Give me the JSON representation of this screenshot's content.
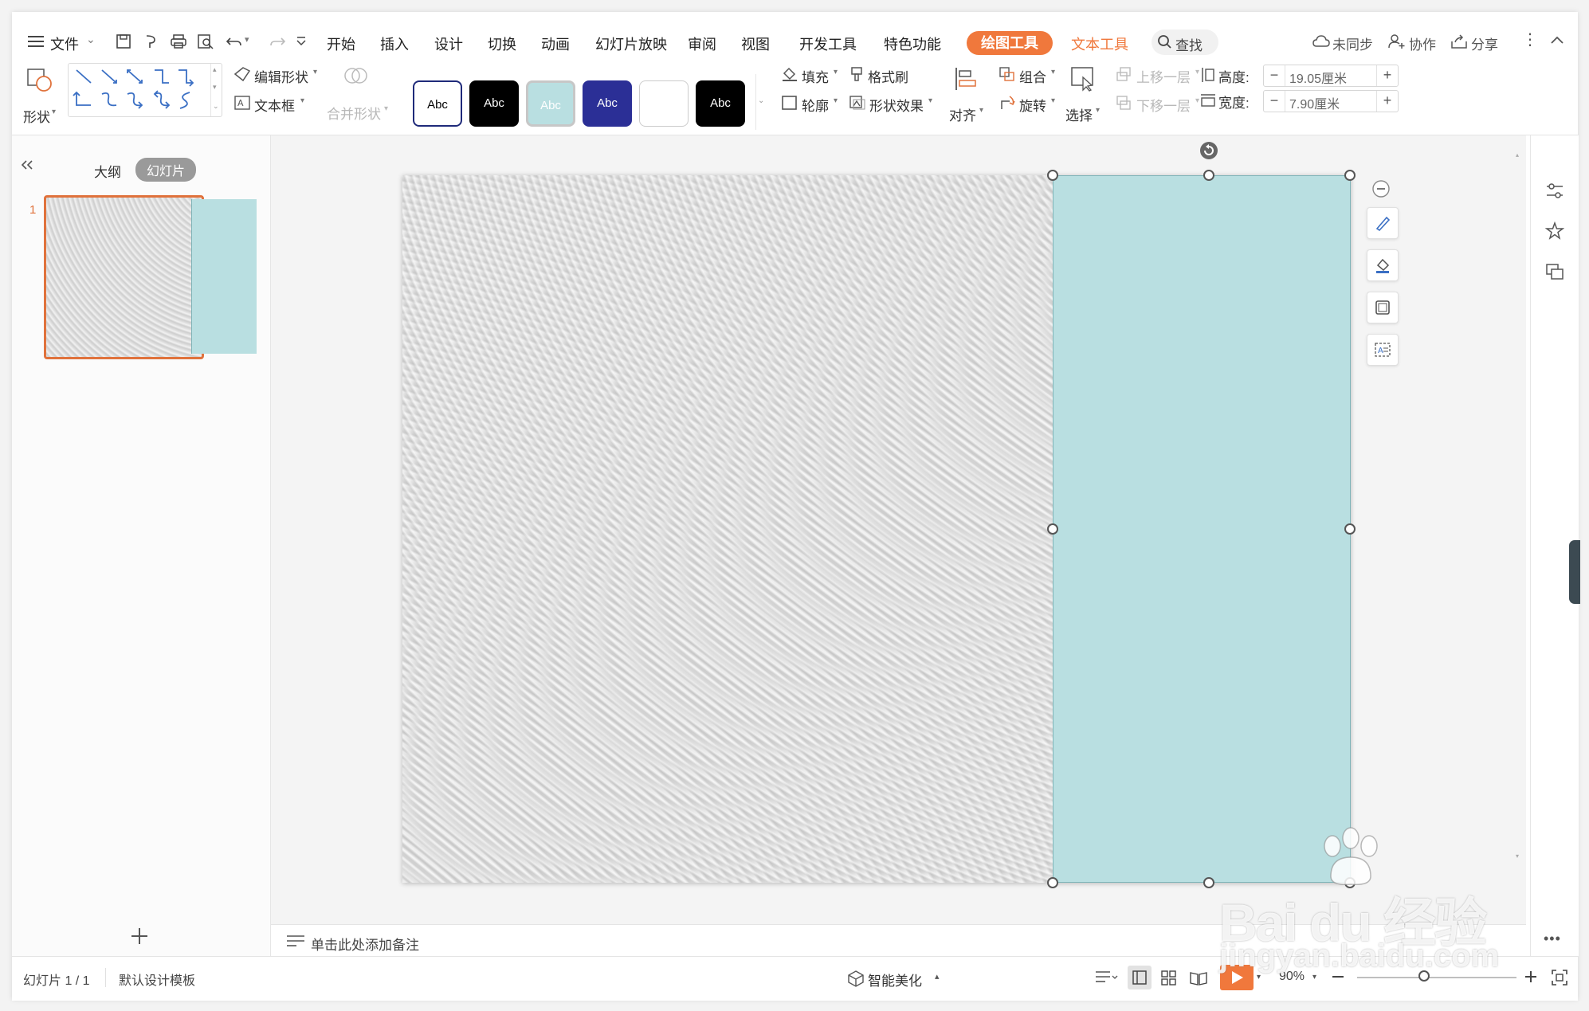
{
  "menubar": {
    "file_label": "文件",
    "tabs": [
      "开始",
      "插入",
      "设计",
      "切换",
      "动画",
      "幻灯片放映",
      "审阅",
      "视图",
      "开发工具",
      "特色功能"
    ],
    "drawing_tools": "绘图工具",
    "text_tools": "文本工具",
    "search_label": "查找",
    "unsync_label": "未同步",
    "collab_label": "协作",
    "share_label": "分享"
  },
  "ribbon": {
    "shape_label": "形状",
    "edit_shape_label": "编辑形状",
    "textbox_label": "文本框",
    "merge_shape_label": "合并形状",
    "style_samples": [
      {
        "text": "Abc",
        "bg": "#ffffff",
        "fg": "#000000",
        "border": "#1f2a7a"
      },
      {
        "text": "Abc",
        "bg": "#000000",
        "fg": "#ffffff",
        "border": "#000000"
      },
      {
        "text": "Abc",
        "bg": "#b9dfe1",
        "fg": "#ffffff",
        "border": "#9fc7ca"
      },
      {
        "text": "Abc",
        "bg": "#2b2f96",
        "fg": "#ffffff",
        "border": "#2b2f96"
      },
      {
        "text": "",
        "bg": "#ffffff",
        "fg": "#000000",
        "border": "#cccccc"
      },
      {
        "text": "Abc",
        "bg": "#000000",
        "fg": "#ffffff",
        "border": "#000000"
      }
    ],
    "fill_label": "填充",
    "format_brush_label": "格式刷",
    "outline_label": "轮廓",
    "shape_effect_label": "形状效果",
    "align_label": "对齐",
    "group_label": "组合",
    "rotate_label": "旋转",
    "select_label": "选择",
    "bring_forward_label": "上移一层",
    "send_backward_label": "下移一层",
    "height_label": "高度:",
    "height_value": "19.05厘米",
    "width_label": "宽度:",
    "width_value": "7.90厘米"
  },
  "leftpane": {
    "outline_tab": "大纲",
    "slides_tab": "幻灯片",
    "slide_number": "1"
  },
  "notes_placeholder": "单击此处添加备注",
  "statusbar": {
    "slide_counter": "幻灯片 1 / 1",
    "template_name": "默认设计模板",
    "beautify_label": "智能美化",
    "zoom_label": "90%"
  },
  "watermark": {
    "brand": "Bai du 经验",
    "url": "jingyan.baidu.com"
  },
  "colors": {
    "accent": "#f0783c",
    "shape_fill": "#b9dfe1",
    "text_tools": "#f0783c"
  }
}
